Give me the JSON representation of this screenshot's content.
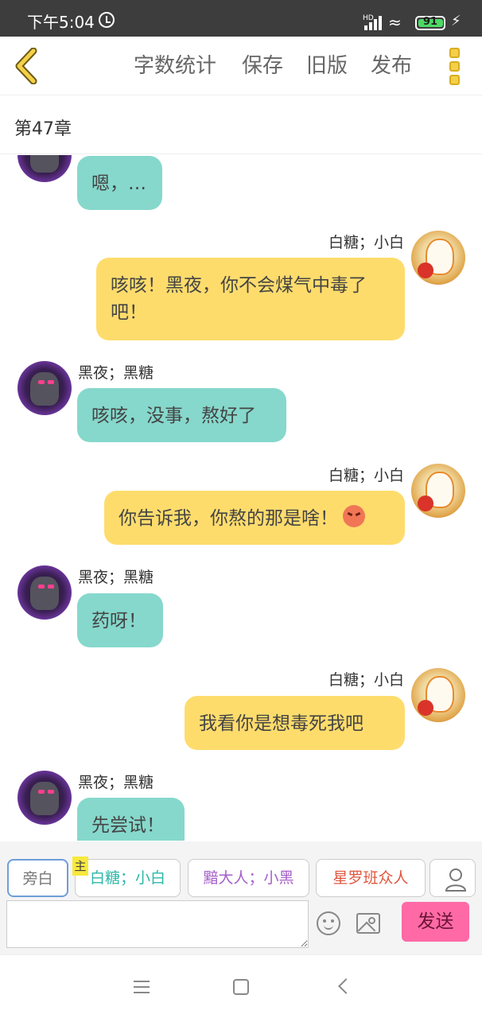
{
  "status_bar": {
    "time": "下午5:04",
    "network": "HD",
    "battery": "91",
    "battery_level": 0.91
  },
  "toolbar": {
    "actions": [
      "字数统计",
      "保存",
      "旧版",
      "发布"
    ]
  },
  "chapter": {
    "title": "第47章"
  },
  "messages": [
    {
      "side": "left",
      "speaker": "",
      "text": "嗯，…"
    },
    {
      "side": "right",
      "speaker": "白糖；小白",
      "text": "咳咳！黑夜，你不会煤气中毒了吧！"
    },
    {
      "side": "left",
      "speaker": "黑夜；黑糖",
      "text": "咳咳，没事，熬好了"
    },
    {
      "side": "right",
      "speaker": "白糖；小白",
      "text": "你告诉我，你熬的那是啥！",
      "emoji": "angry-face-icon"
    },
    {
      "side": "left",
      "speaker": "黑夜；黑糖",
      "text": "药呀！"
    },
    {
      "side": "right",
      "speaker": "白糖；小白",
      "text": "我看你是想毒死我吧"
    },
    {
      "side": "left",
      "speaker": "黑夜；黑糖",
      "text": "先尝试！"
    }
  ],
  "roles": {
    "items": [
      {
        "label": "旁白",
        "color": "#777777"
      },
      {
        "label": "白糖；小白",
        "color": "#2bb7a8",
        "tag": "主"
      },
      {
        "label": "黯大人；小黑",
        "color": "#a65fc9"
      },
      {
        "label": "星罗班众人",
        "color": "#e0573e"
      }
    ]
  },
  "input": {
    "placeholder": "",
    "send_label": "发送"
  },
  "colors": {
    "teal_bubble": "#86d8cc",
    "yellow_bubble": "#fedc6c",
    "send_button": "#ff6aa6",
    "accent": "#f4d04a"
  }
}
